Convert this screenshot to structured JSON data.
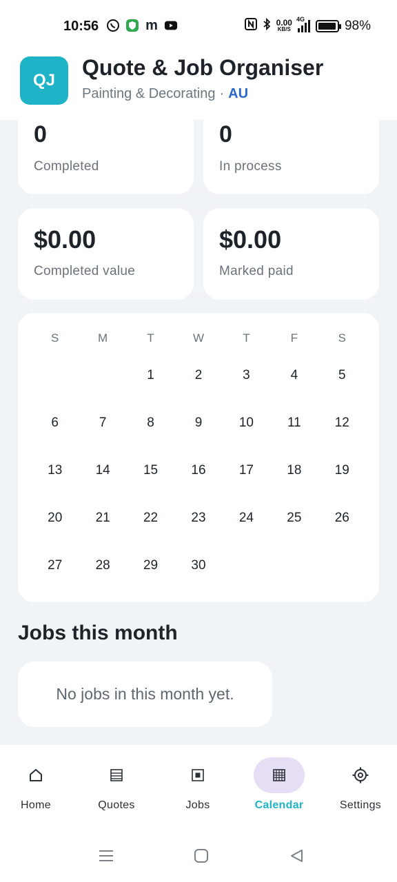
{
  "status_bar": {
    "time": "10:56",
    "left_icons": [
      "viber-icon",
      "shield-icon",
      "m-icon",
      "youtube-icon"
    ],
    "m_glyph": "m",
    "net_speed_value": "0.00",
    "net_speed_unit": "KB/S",
    "network": "4G",
    "battery_percent": "98%",
    "battery_level": 0.98
  },
  "header": {
    "logo_text": "QJ",
    "title": "Quote & Job Organiser",
    "subtitle": "Painting & Decorating",
    "separator": "·",
    "region": "AU",
    "accent_color": "#1eb3c6"
  },
  "stats": [
    {
      "value": "0",
      "label": "Completed"
    },
    {
      "value": "0",
      "label": "In process"
    },
    {
      "value": "$0.00",
      "label": "Completed value"
    },
    {
      "value": "$0.00",
      "label": "Marked paid"
    }
  ],
  "calendar": {
    "weekdays": [
      "S",
      "M",
      "T",
      "W",
      "T",
      "F",
      "S"
    ],
    "leading_blanks": 2,
    "days": [
      "1",
      "2",
      "3",
      "4",
      "5",
      "6",
      "7",
      "8",
      "9",
      "10",
      "11",
      "12",
      "13",
      "14",
      "15",
      "16",
      "17",
      "18",
      "19",
      "20",
      "21",
      "22",
      "23",
      "24",
      "25",
      "26",
      "27",
      "28",
      "29",
      "30"
    ]
  },
  "jobs_section": {
    "title": "Jobs this month",
    "empty_text": "No jobs in this month yet."
  },
  "bottom_nav": {
    "items": [
      {
        "label": "Home",
        "icon": "home-icon",
        "active": false
      },
      {
        "label": "Quotes",
        "icon": "list-icon",
        "active": false
      },
      {
        "label": "Jobs",
        "icon": "job-icon",
        "active": false
      },
      {
        "label": "Calendar",
        "icon": "calendar-icon",
        "active": true
      },
      {
        "label": "Settings",
        "icon": "gear-icon",
        "active": false
      }
    ]
  },
  "system_nav": [
    "menu-icon",
    "home-square-icon",
    "back-icon"
  ]
}
